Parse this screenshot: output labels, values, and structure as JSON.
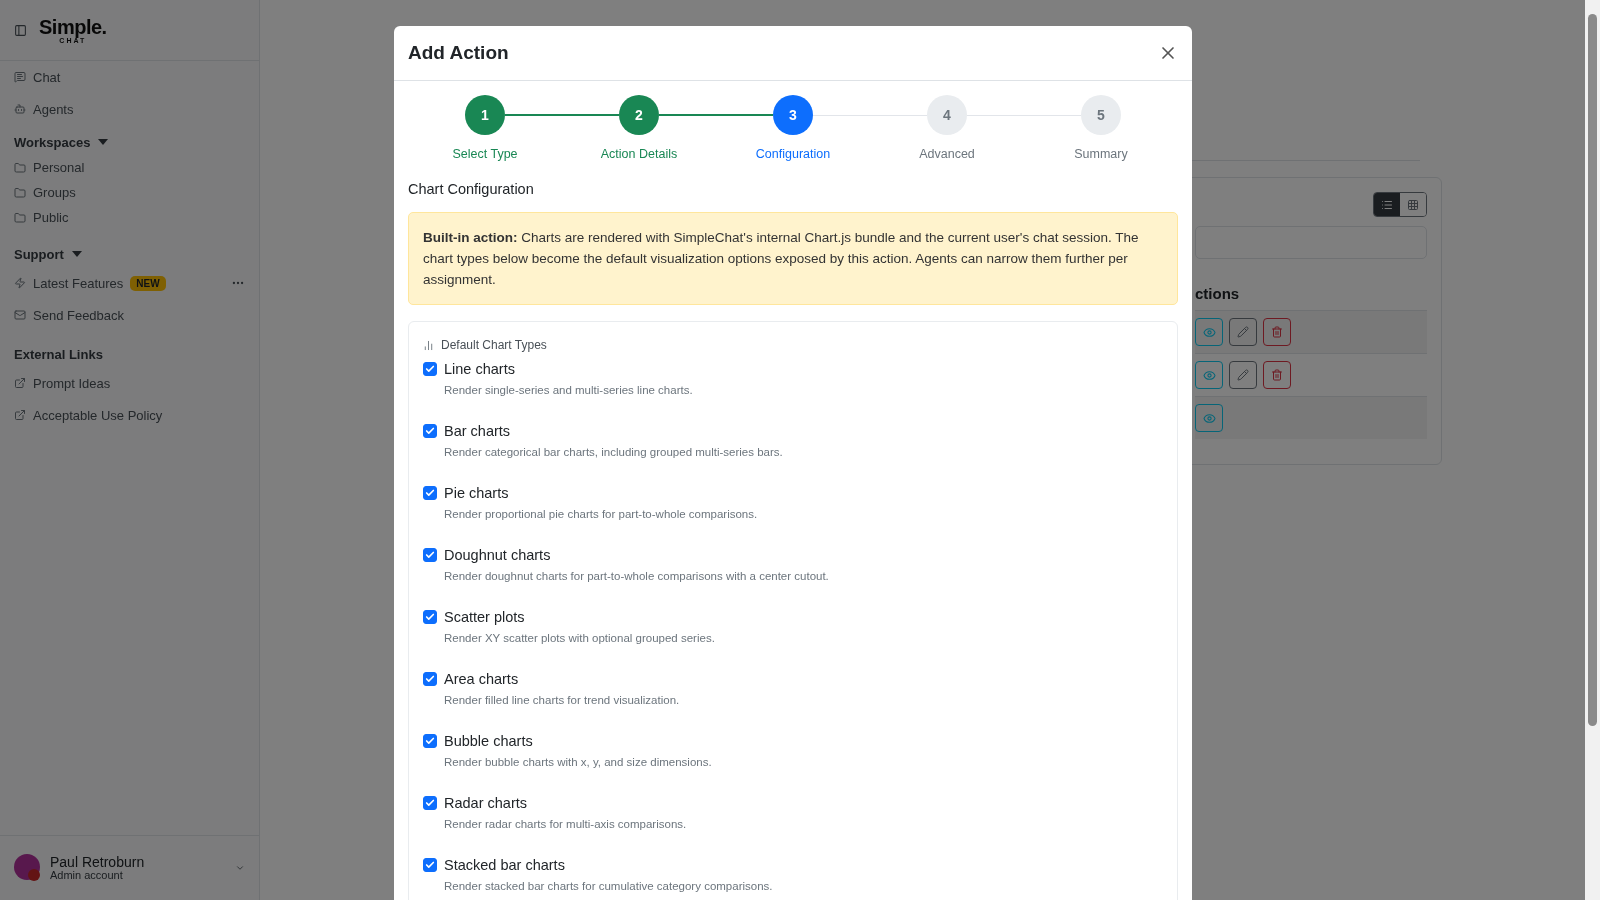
{
  "sidebar": {
    "logo": {
      "name": "Simple.",
      "sub": "CHAT"
    },
    "items": [
      {
        "kind": "link",
        "label": "Chat"
      },
      {
        "kind": "link",
        "label": "Agents"
      },
      {
        "kind": "header",
        "label": "Workspaces",
        "expanded": true
      },
      {
        "kind": "link",
        "label": "Personal"
      },
      {
        "kind": "link",
        "label": "Groups"
      },
      {
        "kind": "link",
        "label": "Public"
      },
      {
        "kind": "header",
        "label": "Support",
        "expanded": true
      },
      {
        "kind": "link",
        "label": "Latest Features",
        "badge": "NEW"
      },
      {
        "kind": "link",
        "label": "Send Feedback"
      },
      {
        "kind": "header",
        "label": "External Links"
      },
      {
        "kind": "link",
        "label": "Prompt Ideas"
      },
      {
        "kind": "link",
        "label": "Acceptable Use Policy"
      }
    ],
    "user": {
      "name": "Paul Retroburn",
      "role": "Admin account"
    }
  },
  "background": {
    "view_toggle": [
      {
        "selected": true
      },
      {
        "selected": false
      }
    ],
    "heading": "ctions",
    "rows": [
      {
        "editable": true
      },
      {
        "editable": true
      },
      {
        "editable": false
      }
    ]
  },
  "modal": {
    "title": "Add Action",
    "steps": [
      {
        "number": "1",
        "label": "Select Type",
        "complete": true,
        "selected": false
      },
      {
        "number": "2",
        "label": "Action Details",
        "complete": true,
        "selected": false
      },
      {
        "number": "3",
        "label": "Configuration",
        "complete": false,
        "selected": true
      },
      {
        "number": "4",
        "label": "Advanced",
        "complete": false,
        "selected": false
      },
      {
        "number": "5",
        "label": "Summary",
        "complete": false,
        "selected": false
      }
    ],
    "section_title": "Chart Configuration",
    "alert": "**Built-in action:** Charts are rendered with SimpleChat's internal Chart.js bundle and the current user's chat session. The chart types below become the default visualization options exposed by this action. Agents can narrow them further per assignment.",
    "options_title": "Default Chart Types",
    "options": [
      {
        "label": "Line charts",
        "description": "Render single-series and multi-series line charts.",
        "checked": true
      },
      {
        "label": "Bar charts",
        "description": "Render categorical bar charts, including grouped multi-series bars.",
        "checked": true
      },
      {
        "label": "Pie charts",
        "description": "Render proportional pie charts for part-to-whole comparisons.",
        "checked": true
      },
      {
        "label": "Doughnut charts",
        "description": "Render doughnut charts for part-to-whole comparisons with a center cutout.",
        "checked": true
      },
      {
        "label": "Scatter plots",
        "description": "Render XY scatter plots with optional grouped series.",
        "checked": true
      },
      {
        "label": "Area charts",
        "description": "Render filled line charts for trend visualization.",
        "checked": true
      },
      {
        "label": "Bubble charts",
        "description": "Render bubble charts with x, y, and size dimensions.",
        "checked": true
      },
      {
        "label": "Radar charts",
        "description": "Render radar charts for multi-axis comparisons.",
        "checked": true
      },
      {
        "label": "Stacked bar charts",
        "description": "Render stacked bar charts for cumulative category comparisons.",
        "checked": true
      }
    ]
  }
}
